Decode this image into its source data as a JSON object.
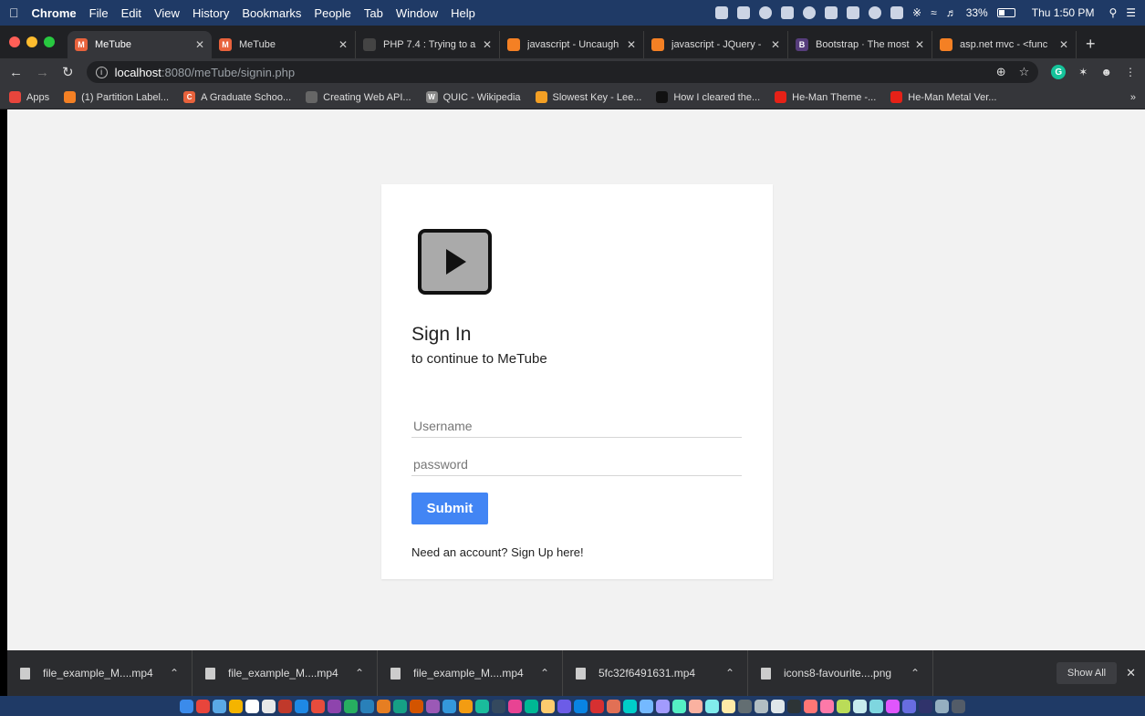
{
  "menubar": {
    "app": "Chrome",
    "menus": [
      "File",
      "Edit",
      "View",
      "History",
      "Bookmarks",
      "People",
      "Tab",
      "Window",
      "Help"
    ],
    "battery": "33%",
    "clock": "Thu 1:50 PM"
  },
  "tabs": [
    {
      "title": "MeTube",
      "favicon": "M",
      "color": "#e8623c",
      "active": true
    },
    {
      "title": "MeTube",
      "favicon": "M",
      "color": "#e8623c",
      "active": false
    },
    {
      "title": "PHP 7.4 : Trying to a",
      "favicon": "github-icon",
      "color": "#444444",
      "active": false
    },
    {
      "title": "javascript - Uncaugh",
      "favicon": "stackoverflow-icon",
      "color": "#f48024",
      "active": false
    },
    {
      "title": "javascript - JQuery -",
      "favicon": "stackoverflow-icon",
      "color": "#f48024",
      "active": false
    },
    {
      "title": "Bootstrap · The most",
      "favicon": "B",
      "color": "#563d7c",
      "active": false
    },
    {
      "title": "asp.net mvc - <func",
      "favicon": "stackoverflow-icon",
      "color": "#f48024",
      "active": false
    }
  ],
  "address": {
    "host": "localhost",
    "path": ":8080/meTube/signin.php"
  },
  "bookmarks": [
    {
      "label": "Apps",
      "color": "#e8453c",
      "icon": "apps-grid-icon"
    },
    {
      "label": "(1) Partition Label...",
      "color": "#f48024",
      "icon": ""
    },
    {
      "label": "A Graduate Schoo...",
      "color": "#e8623c",
      "icon": "C"
    },
    {
      "label": "Creating Web API...",
      "color": "#666666",
      "icon": ""
    },
    {
      "label": "QUIC - Wikipedia",
      "color": "#888888",
      "icon": "W"
    },
    {
      "label": "Slowest Key - Lee...",
      "color": "#f4a024",
      "icon": ""
    },
    {
      "label": "How I cleared the...",
      "color": "#111111",
      "icon": ""
    },
    {
      "label": "He-Man Theme -...",
      "color": "#e62117",
      "icon": ""
    },
    {
      "label": "He-Man Metal Ver...",
      "color": "#e62117",
      "icon": ""
    }
  ],
  "signin": {
    "heading": "Sign In",
    "subheading": "to continue to MeTube",
    "username_placeholder": "Username",
    "password_placeholder": "password",
    "submit_label": "Submit",
    "signup_text": "Need an account? Sign Up here!"
  },
  "downloads": {
    "items": [
      {
        "name": "file_example_M....mp4"
      },
      {
        "name": "file_example_M....mp4"
      },
      {
        "name": "file_example_M....mp4"
      },
      {
        "name": "5fc32f6491631.mp4"
      },
      {
        "name": "icons8-favourite....png"
      }
    ],
    "show_all": "Show All"
  },
  "colors": {
    "accent": "#4285f4",
    "page_bg": "#f2f2f2",
    "card_bg": "#ffffff"
  }
}
